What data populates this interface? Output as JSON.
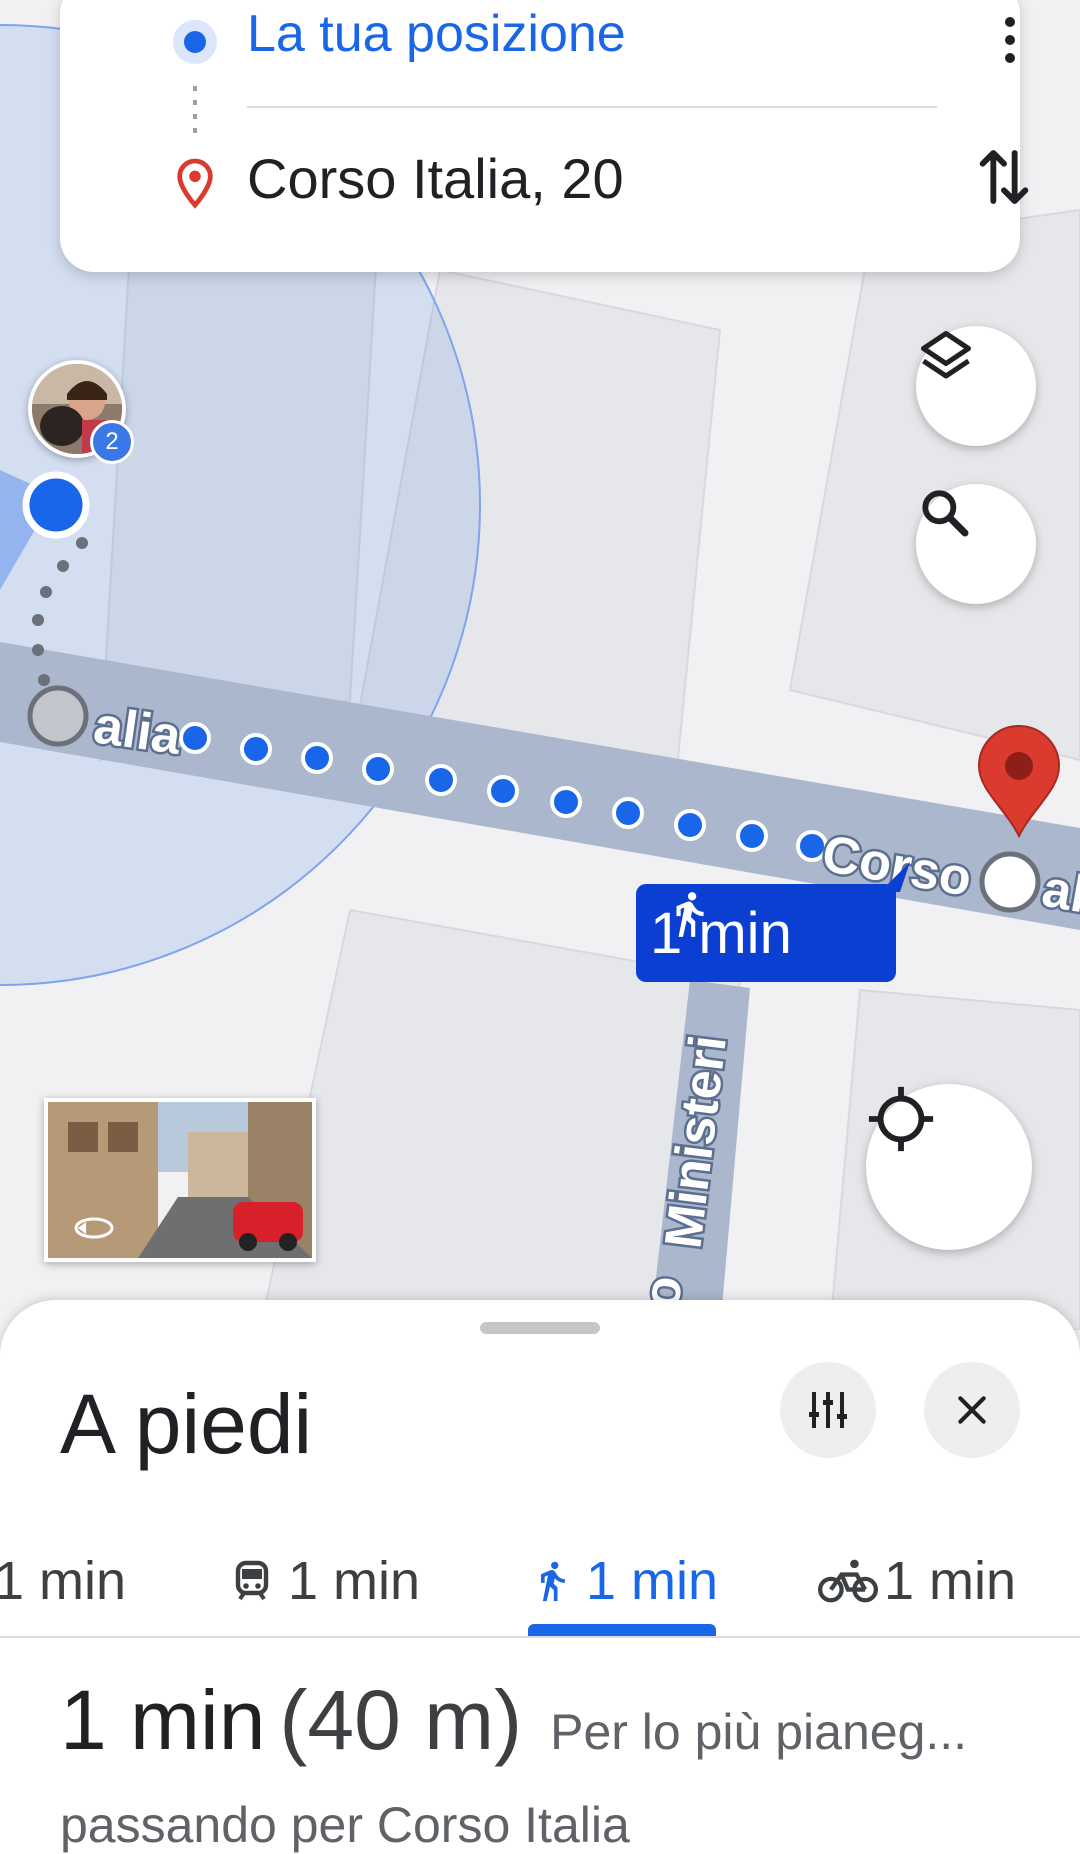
{
  "directions": {
    "origin": "La tua posizione",
    "destination": "Corso Italia, 20",
    "menu_icon": "more-vert-icon",
    "swap_icon": "swap-vertical-icon"
  },
  "map": {
    "street_labels": [
      "alia",
      "Corso",
      "al",
      "Ministeri",
      "o"
    ],
    "avatar_badge": "2",
    "route_chip": "1 min",
    "route_color": "#1a66e8",
    "destination_pin_color": "#db3a2f",
    "buttons": [
      "layers-icon",
      "search-icon",
      "my-location-icon"
    ]
  },
  "sheet": {
    "title": "A piedi",
    "tabs": [
      {
        "icon": "car-icon",
        "label": "1 min"
      },
      {
        "icon": "transit-icon",
        "label": "1 min"
      },
      {
        "icon": "walk-icon",
        "label": "1 min",
        "active": true
      },
      {
        "icon": "bike-icon",
        "label": "1 min"
      }
    ],
    "summary_time": "1 min",
    "summary_distance": "(40 m)",
    "summary_desc": "Per lo più pianeg...",
    "via": "passando per Corso Italia"
  }
}
